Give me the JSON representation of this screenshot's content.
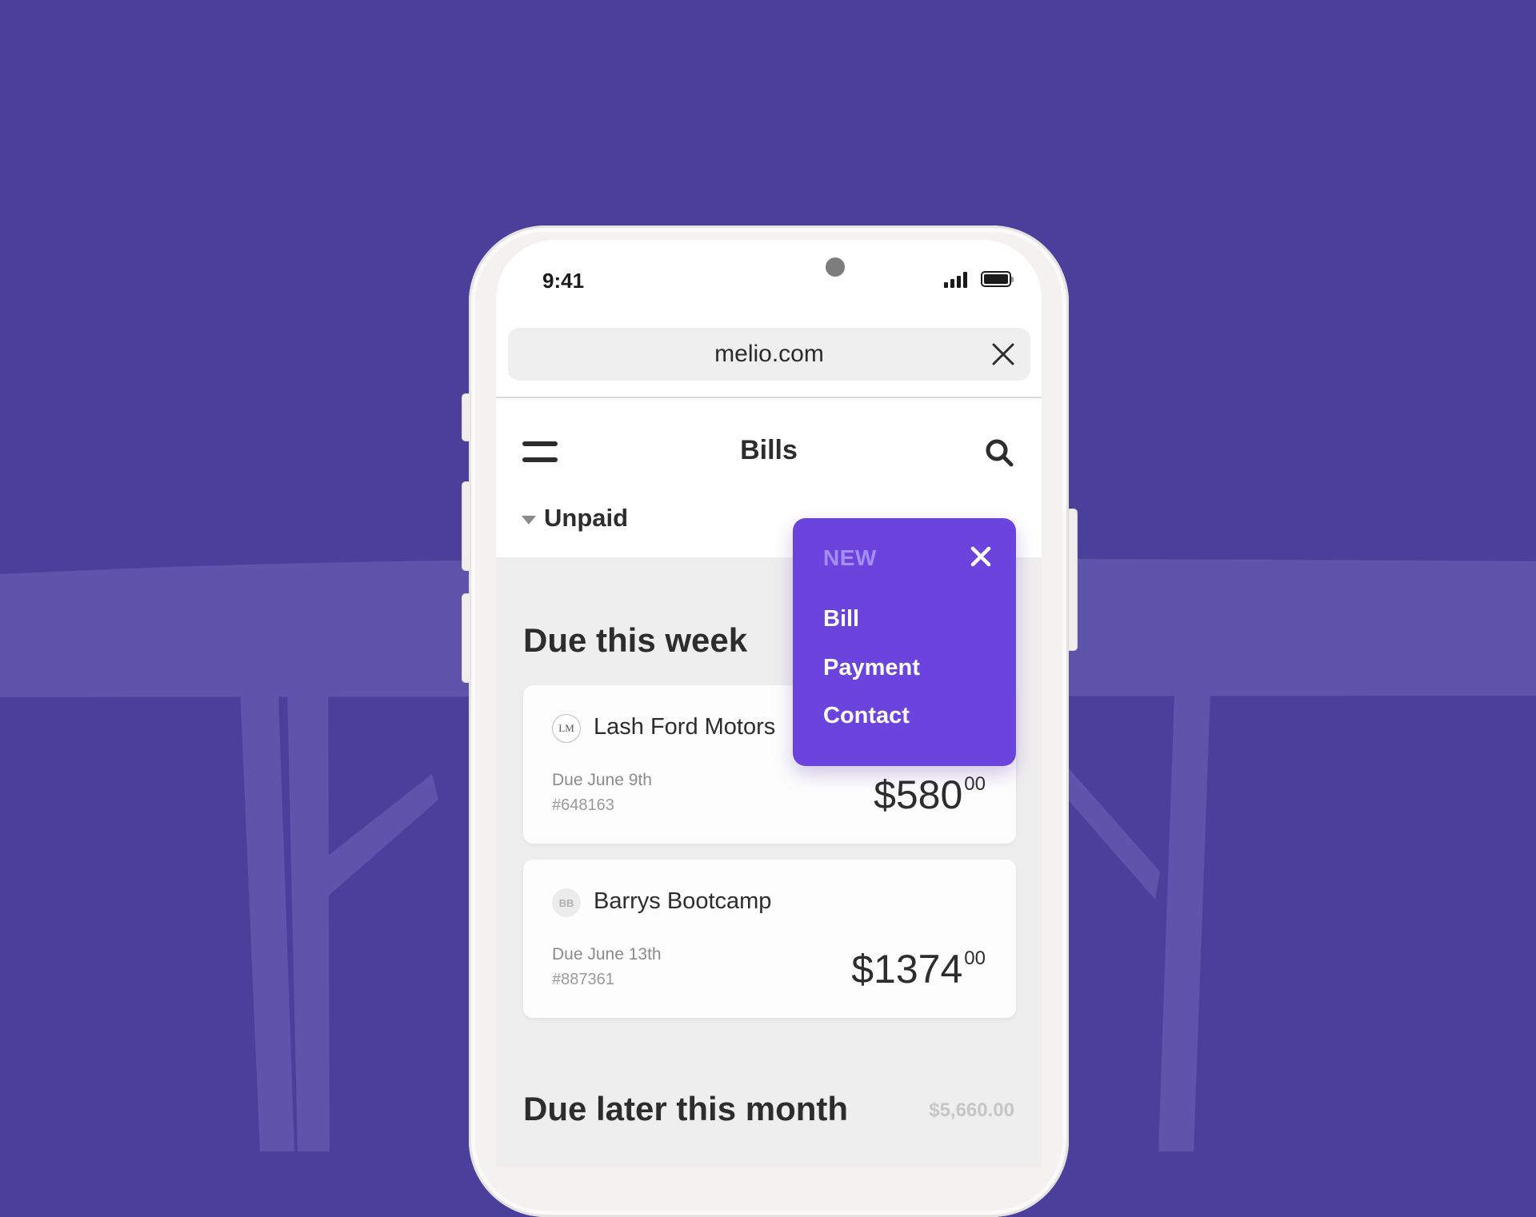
{
  "colors": {
    "background": "#4b3f9c",
    "background_shape": "#5e54ab",
    "accent": "#6b43dd",
    "popup_title": "#a58ef0",
    "text_primary": "#2d2d2d",
    "text_secondary": "#8b8b8b"
  },
  "status_bar": {
    "time": "9:41",
    "icons": [
      "signal-icon",
      "battery-icon"
    ]
  },
  "browser": {
    "url": "melio.com",
    "close_icon": "close-icon"
  },
  "header": {
    "menu_icon": "hamburger-icon",
    "title": "Bills",
    "search_icon": "search-icon"
  },
  "filter": {
    "selected": "Unpaid",
    "icon": "caret-down-icon"
  },
  "new_menu": {
    "title": "NEW",
    "close_icon": "close-icon",
    "items": [
      {
        "label": "Bill"
      },
      {
        "label": "Payment"
      },
      {
        "label": "Contact"
      }
    ]
  },
  "sections": [
    {
      "title": "Due this week",
      "bills": [
        {
          "initials": "LM",
          "vendor": "Lash Ford Motors",
          "due": "Due June 9th",
          "invoice": "#648163",
          "amount_whole": "$580",
          "amount_cents": "00"
        },
        {
          "initials": "BB",
          "vendor": "Barrys Bootcamp",
          "due": "Due June 13th",
          "invoice": "#887361",
          "amount_whole": "$1374",
          "amount_cents": "00"
        }
      ]
    },
    {
      "title": "Due later this month",
      "total": "$5,660.00"
    }
  ]
}
